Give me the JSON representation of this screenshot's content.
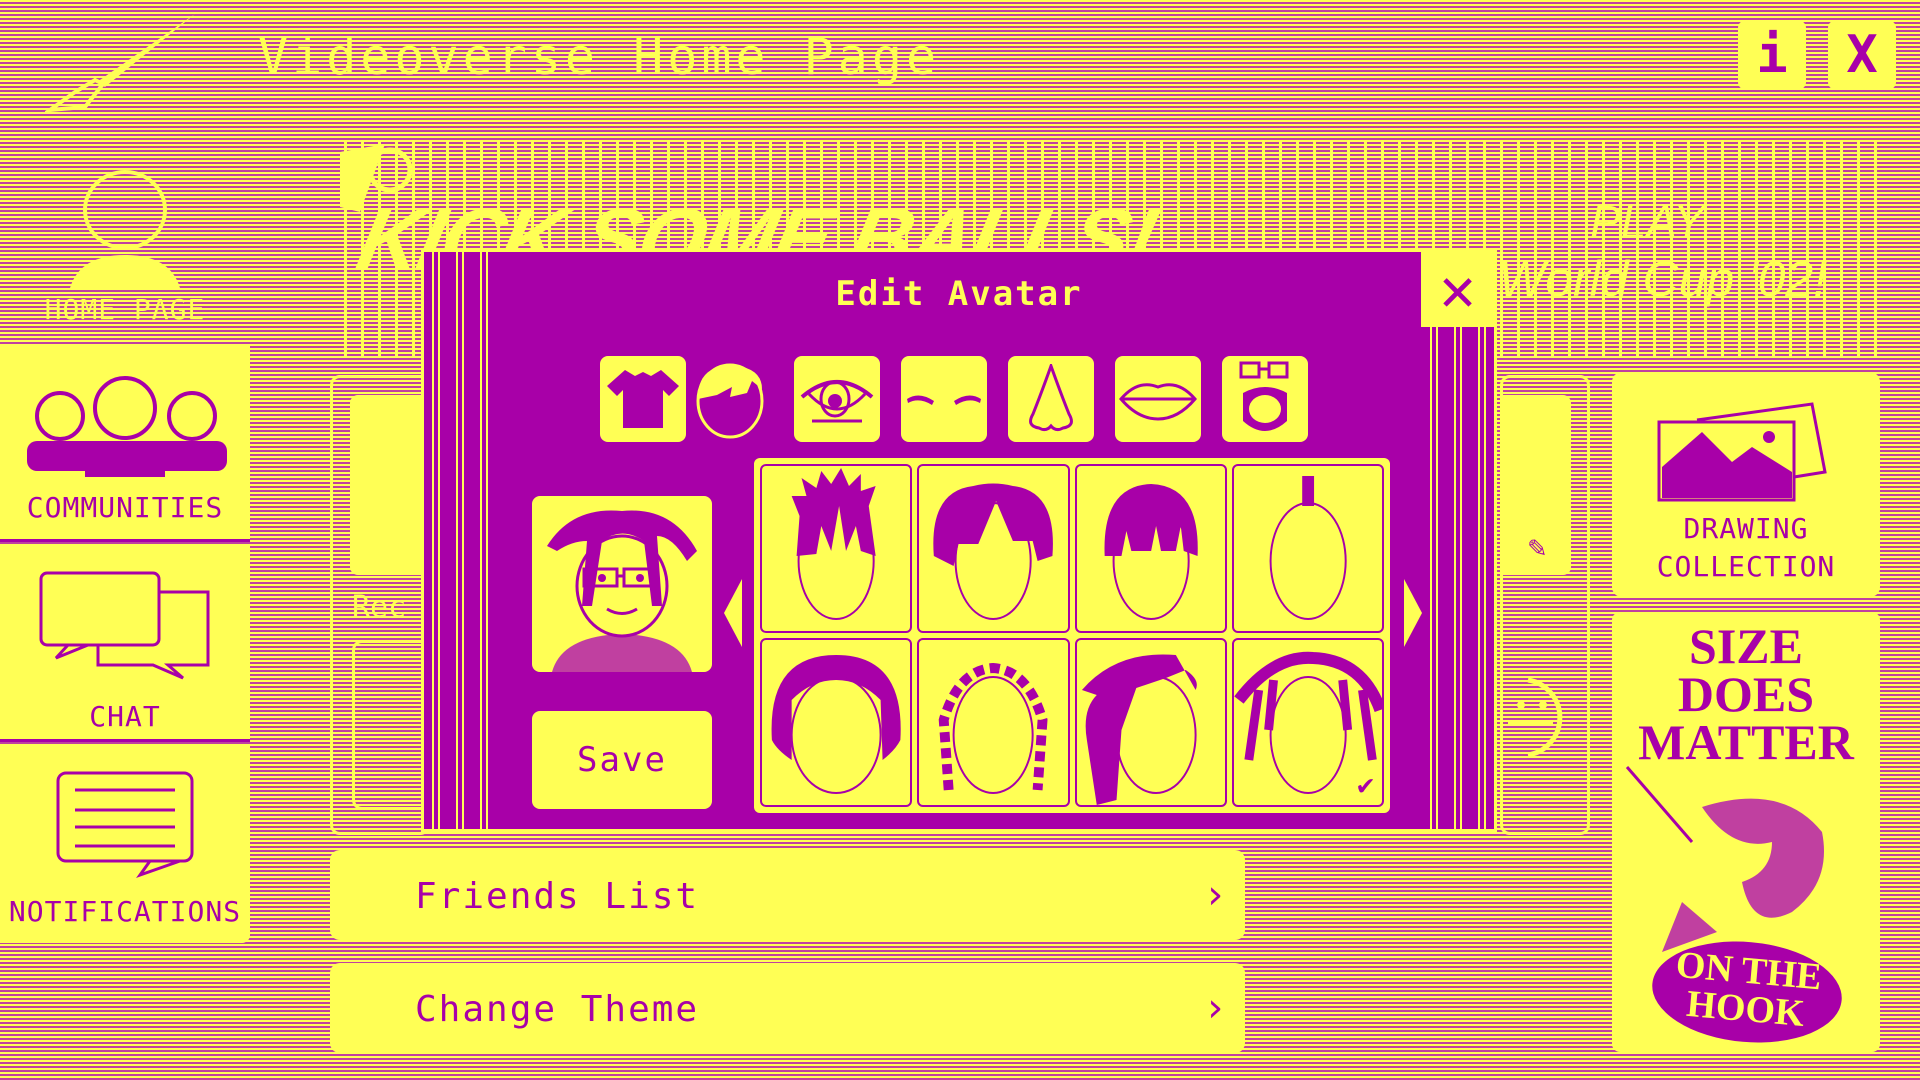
{
  "colors": {
    "yellow": "#ffff55",
    "purple": "#a800a8",
    "stripe": "#c040a0"
  },
  "header": {
    "title": "Videoverse Home Page",
    "logo_icon": "paintbrush-icon",
    "info_label": "i",
    "close_label": "X"
  },
  "sidebar": {
    "items": [
      {
        "label": "HOME PAGE",
        "icon": "person-icon"
      },
      {
        "label": "COMMUNITIES",
        "icon": "group-icon"
      },
      {
        "label": "CHAT",
        "icon": "chat-bubbles-icon"
      },
      {
        "label": "NOTIFICATIONS",
        "icon": "message-icon"
      }
    ]
  },
  "banner": {
    "left_text": "KICK SOME BALLS!",
    "right_line1": "PLAY",
    "right_line2": "World Cup '02!"
  },
  "background": {
    "recent_label": "Rec"
  },
  "right_panel": {
    "drawing_collection_line1": "DRAWING",
    "drawing_collection_line2": "COLLECTION",
    "ad_headline_line1": "SIZE",
    "ad_headline_line2": "DOES",
    "ad_headline_line3": "MATTER",
    "ad_brand_line1": "ON THE",
    "ad_brand_line2": "HOOK"
  },
  "list_buttons": [
    {
      "label": "Friends List",
      "chevron": "›"
    },
    {
      "label": "Change Theme",
      "chevron": "›"
    }
  ],
  "dialog": {
    "title": "Edit Avatar",
    "close_label": "✕",
    "save_label": "Save",
    "tabs": [
      {
        "name": "shirt",
        "icon": "shirt-icon",
        "selected": false
      },
      {
        "name": "hair",
        "icon": "hair-icon",
        "selected": true
      },
      {
        "name": "eyes",
        "icon": "eye-icon",
        "selected": false
      },
      {
        "name": "eyebrows",
        "icon": "eyebrows-icon",
        "selected": false
      },
      {
        "name": "nose",
        "icon": "nose-icon",
        "selected": false
      },
      {
        "name": "mouth",
        "icon": "lips-icon",
        "selected": false
      },
      {
        "name": "accessories",
        "icon": "glasses-beard-icon",
        "selected": false
      }
    ],
    "hair_options": [
      {
        "style": "spiky",
        "selected": false
      },
      {
        "style": "bowl-parted",
        "selected": false
      },
      {
        "style": "straight-bangs",
        "selected": false
      },
      {
        "style": "mohawk",
        "selected": false
      },
      {
        "style": "afro",
        "selected": false
      },
      {
        "style": "cornrows",
        "selected": false
      },
      {
        "style": "long-side-swept",
        "selected": false
      },
      {
        "style": "dreadlocks",
        "selected": true
      }
    ],
    "selected_mark": "✔"
  }
}
